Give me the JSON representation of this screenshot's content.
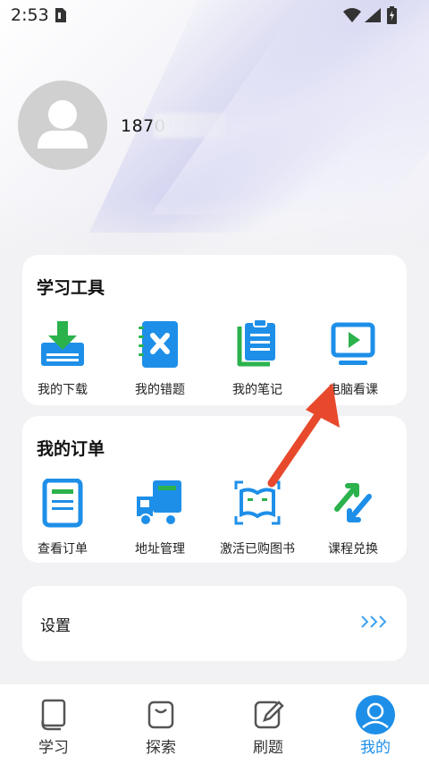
{
  "status": {
    "time": "2:53"
  },
  "profile": {
    "phone": "1870"
  },
  "tools": {
    "title": "学习工具",
    "items": [
      {
        "label": "我的下载",
        "icon": "download-icon"
      },
      {
        "label": "我的错题",
        "icon": "wrong-questions-icon"
      },
      {
        "label": "我的笔记",
        "icon": "notes-icon"
      },
      {
        "label": "电脑看课",
        "icon": "pc-video-icon"
      }
    ]
  },
  "orders": {
    "title": "我的订单",
    "items": [
      {
        "label": "查看订单",
        "icon": "order-list-icon"
      },
      {
        "label": "地址管理",
        "icon": "delivery-truck-icon"
      },
      {
        "label": "激活已购图书",
        "icon": "scan-book-icon"
      },
      {
        "label": "课程兑换",
        "icon": "exchange-icon"
      }
    ]
  },
  "settings": {
    "label": "设置"
  },
  "tabbar": {
    "items": [
      {
        "label": "学习",
        "icon": "book-icon"
      },
      {
        "label": "探索",
        "icon": "bag-icon"
      },
      {
        "label": "刷题",
        "icon": "edit-icon"
      },
      {
        "label": "我的",
        "icon": "user-icon"
      }
    ],
    "active": "我的",
    "accent": "#1e8fe8"
  }
}
